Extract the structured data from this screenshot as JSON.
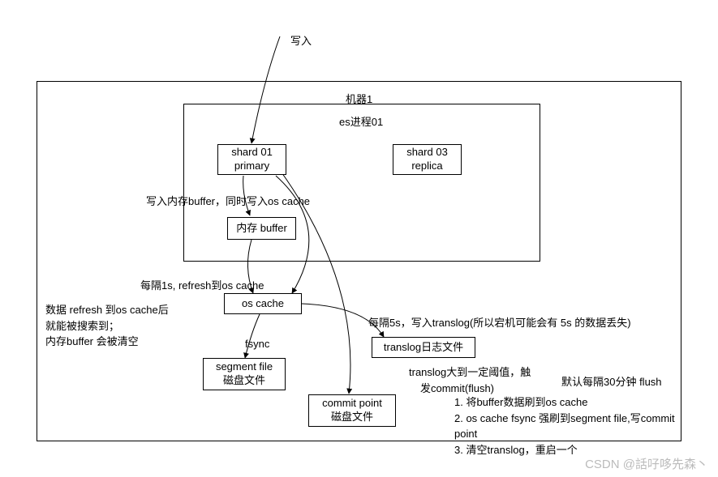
{
  "labels": {
    "write_in": "写入",
    "machine1": "机器1",
    "es_process": "es进程01",
    "shard01_l1": "shard 01",
    "shard01_l2": "primary",
    "shard03_l1": "shard 03",
    "shard03_l2": "replica",
    "buffer_note": "写入内存buffer，同时写入os cache",
    "mem_buffer": "内存 buffer",
    "refresh_note": "每隔1s, refresh到os cache",
    "refresh_desc_l1": "数据 refresh 到os cache后",
    "refresh_desc_l2": "就能被搜索到；",
    "refresh_desc_l3": "内存buffer 会被清空",
    "os_cache": "os cache",
    "fsync": "fsync",
    "segment_l1": "segment file",
    "segment_l2": "磁盘文件",
    "commit_l1": "commit point",
    "commit_l2": "磁盘文件",
    "translog_note": "每隔5s，写入translog(所以宕机可能会有 5s 的数据丢失)",
    "translog_file": "translog日志文件",
    "translog_trigger_l1": "translog大到一定阈值，触",
    "translog_trigger_l2": "发commit(flush)",
    "flush_default": "默认每隔30分钟 flush",
    "flush_step1": "1. 将buffer数据刷到os cache",
    "flush_step2": "2. os cache fsync 强刷到segment file,写commit point",
    "flush_step3": "3. 清空translog，重启一个",
    "watermark": "CSDN @話吇哆先森丶"
  }
}
